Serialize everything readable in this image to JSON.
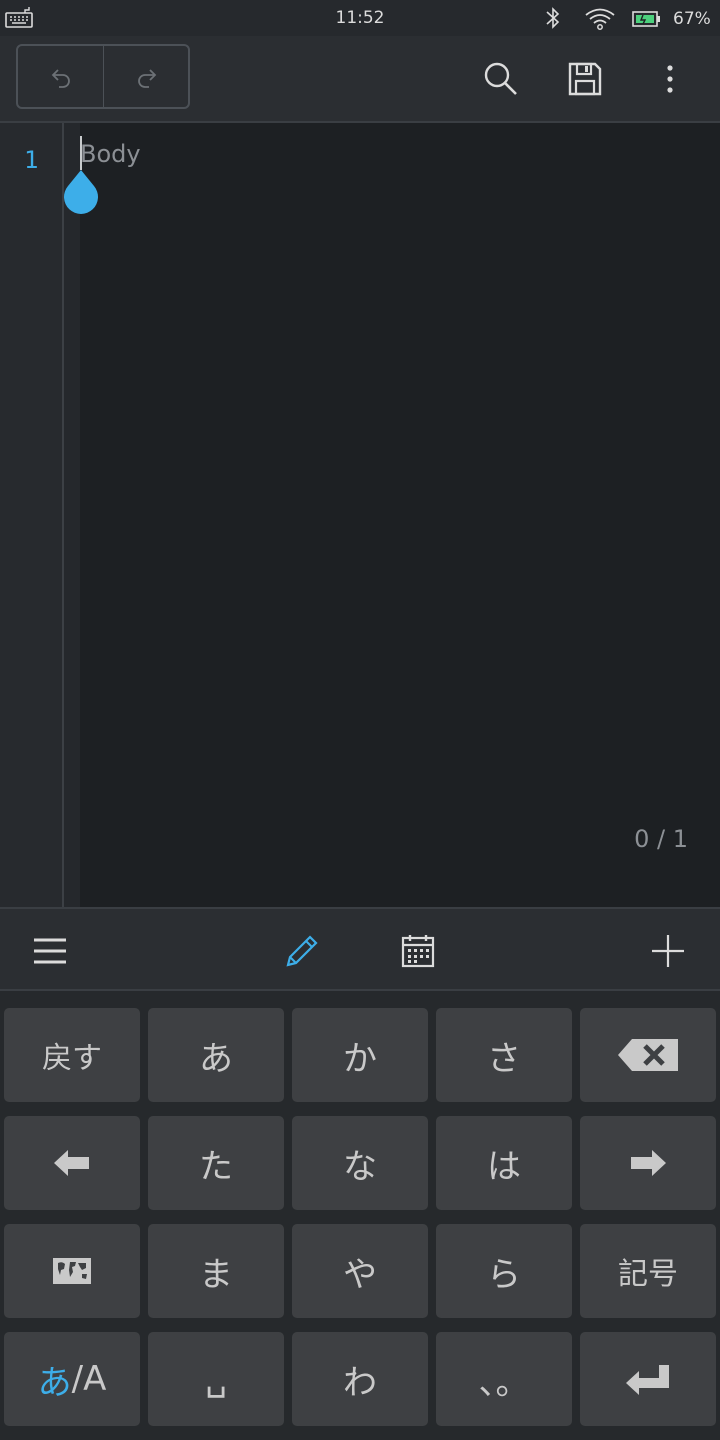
{
  "status_bar": {
    "time": "11:52",
    "battery": "67%",
    "icons": [
      "keyboard-icon",
      "bluetooth-icon",
      "wifi-icon",
      "battery-icon"
    ]
  },
  "toolbar": {
    "icons": [
      "undo-icon",
      "redo-icon",
      "search-icon",
      "save-icon",
      "more-vert-icon"
    ]
  },
  "editor": {
    "line_numbers": [
      "1"
    ],
    "placeholder": "Body",
    "counter": "0 / 1"
  },
  "keyboard_toolbar": {
    "icons": [
      "menu-icon",
      "pencil-icon",
      "calendar-icon",
      "plus-icon"
    ],
    "active": "pencil-icon"
  },
  "keyboard": {
    "keys": {
      "undo": "戻す",
      "a": "あ",
      "ka": "か",
      "sa": "さ",
      "ta": "た",
      "na": "な",
      "ha": "は",
      "ma": "ま",
      "ya": "や",
      "ra": "ら",
      "symbols": "記号",
      "mode_a": "あ",
      "mode_sep": "/",
      "mode_b": "A",
      "space": "␣",
      "wa": "わ",
      "punct": "、。"
    },
    "icons": [
      "backspace-icon",
      "arrow-left-icon",
      "arrow-right-icon",
      "world-map-icon",
      "enter-icon"
    ]
  },
  "colors": {
    "accent": "#3daee9",
    "background": "#1d2023",
    "key": "#3e4043"
  }
}
